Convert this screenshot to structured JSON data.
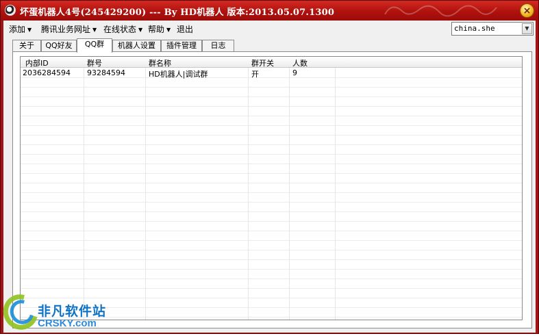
{
  "window": {
    "title": "坏蛋机器人4号(245429200) --- By HD机器人 版本:2013.05.07.1300",
    "close_glyph": "×"
  },
  "menu": {
    "items": [
      {
        "label": "添加",
        "dropdown": true
      },
      {
        "label": "腾讯业务网址",
        "dropdown": true
      },
      {
        "label": "在线状态",
        "dropdown": true
      },
      {
        "label": "帮助",
        "dropdown": true
      },
      {
        "label": "退出",
        "dropdown": false
      }
    ],
    "arrow_glyph": "▼"
  },
  "server_select": {
    "value": "china.she",
    "arrow_glyph": "▼"
  },
  "tabs": [
    {
      "label": "关于",
      "active": false
    },
    {
      "label": "QQ好友",
      "active": false
    },
    {
      "label": "QQ群",
      "active": true
    },
    {
      "label": "机器人设置",
      "active": false
    },
    {
      "label": "插件管理",
      "active": false
    },
    {
      "label": "日志",
      "active": false
    }
  ],
  "group_table": {
    "columns": [
      "内部ID",
      "群号",
      "群名称",
      "群开关",
      "人数"
    ],
    "rows": [
      [
        "2036284594",
        "93284594",
        "HD机器人|调试群",
        "开",
        "9"
      ]
    ]
  },
  "watermark": {
    "text_cn": "非凡软件站",
    "text_en": "CRSKY.com"
  },
  "colors": {
    "titlebar": "#b0110d",
    "close_button": "#f2b21a",
    "background": "#f0f0f0",
    "watermark": "#0e73c7"
  }
}
